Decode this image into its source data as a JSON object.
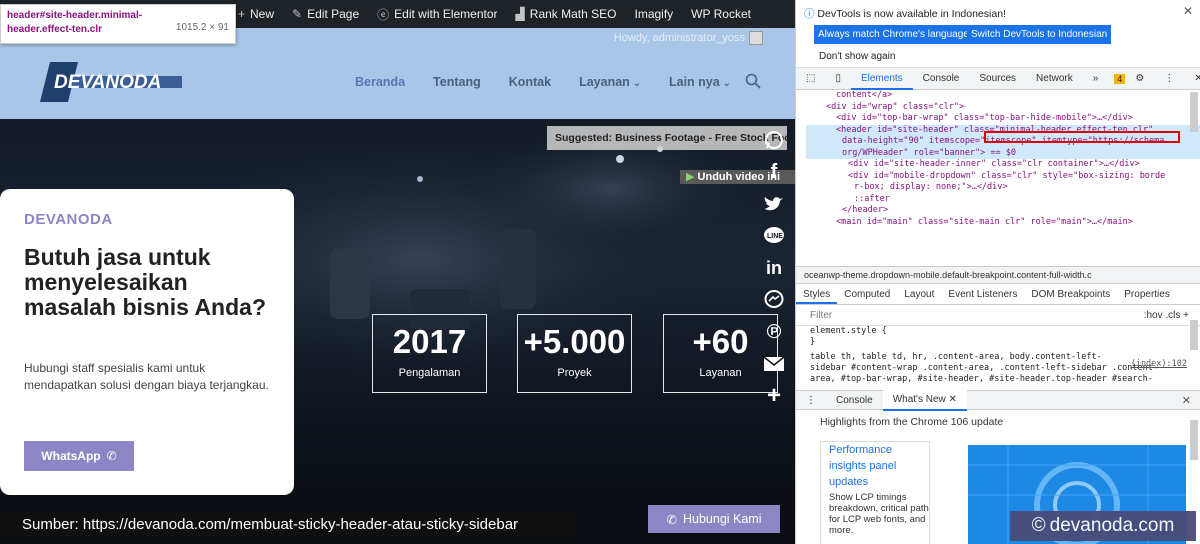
{
  "tooltip": {
    "selector": "header#site-header.minimal-header.effect-ten.clr",
    "size": "1015.2 × 91"
  },
  "adminbar": {
    "items": [
      "New",
      "Edit Page",
      "Edit with Elementor",
      "Rank Math SEO",
      "Imagify",
      "WP Rocket"
    ],
    "howdy": "Howdy, administrator_yoss"
  },
  "header": {
    "logo": "DEVANODA",
    "nav": [
      "Beranda",
      "Tentang",
      "Kontak",
      "Layanan",
      "Lain nya"
    ]
  },
  "hero": {
    "suggested": "Suggested: Business Footage - Free Stock Footage",
    "download": "Unduh video ini",
    "card": {
      "brand": "DEVANODA",
      "heading": "Butuh jasa untuk menyelesaikan masalah bisnis Anda?",
      "text": "Hubungi staff spesialis kami untuk mendapatkan solusi dengan biaya terjangkau.",
      "button": "WhatsApp"
    },
    "stats": [
      {
        "num": "2017",
        "label": "Pengalaman"
      },
      {
        "num": "+5.000",
        "label": "Proyek"
      },
      {
        "num": "+60",
        "label": "Layanan"
      }
    ],
    "contact_button": "Hubungi Kami",
    "source": "Sumber:  https://devanoda.com/membuat-sticky-header-atau-sticky-sidebar"
  },
  "share_icons": [
    "whatsapp-icon",
    "facebook-icon",
    "twitter-icon",
    "line-icon",
    "linkedin-icon",
    "messenger-icon",
    "pinterest-icon",
    "email-icon",
    "plus-icon"
  ],
  "devtools": {
    "notice": "DevTools is now available in Indonesian!",
    "btn1": "Always match Chrome's language",
    "btn2": "Switch DevTools to Indonesian",
    "btn3": "Don't show again",
    "tabs": [
      "Elements",
      "Console",
      "Sources",
      "Network"
    ],
    "warnings": "4",
    "dom": [
      "content</a>",
      "<div id=\"wrap\" class=\"clr\">",
      "<div id=\"top-bar-wrap\" class=\"top-bar-hide-mobile\">…</div>",
      "<header id=\"site-header\" class=\"minimal-header effect-ten clr\"",
      "data-height=\"90\" itemscope=\"itemscope\" itemtype=\"https://schema.",
      "org/WPHeader\" role=\"banner\"> == $0",
      "<div id=\"site-header-inner\" class=\"clr container\">…</div>",
      "<div id=\"mobile-dropdown\" class=\"clr\" style=\"box-sizing: borde",
      "r-box; display: none;\">…</div>",
      "::after",
      "</header>",
      "<main id=\"main\" class=\"site-main clr\" role=\"main\">…</main>"
    ],
    "breadcrumb": "oceanwp-theme.dropdown-mobile.default-breakpoint.content-full-width.c",
    "style_tabs": [
      "Styles",
      "Computed",
      "Layout",
      "Event Listeners",
      "DOM Breakpoints",
      "Properties"
    ],
    "filter": "Filter",
    "filter_right": ":hov  .cls  +",
    "styles": [
      "element.style {",
      "}",
      "table th, table td, hr, .content-area, body.content-left-",
      "sidebar #content-wrap .content-area, .content-left-sidebar .content-",
      "area, #top-bar-wrap, #site-header, #site-header.top-header #search-"
    ],
    "style_src": "(index):102",
    "drawer_tabs": [
      "Console",
      "What's New"
    ],
    "whats_new": "Highlights from the Chrome 106 update",
    "wn_links": [
      "Performance",
      "insights panel",
      "updates"
    ],
    "wn_text": "Show LCP timings breakdown, critical path for LCP web fonts, and more."
  },
  "watermark": "devanoda.com"
}
